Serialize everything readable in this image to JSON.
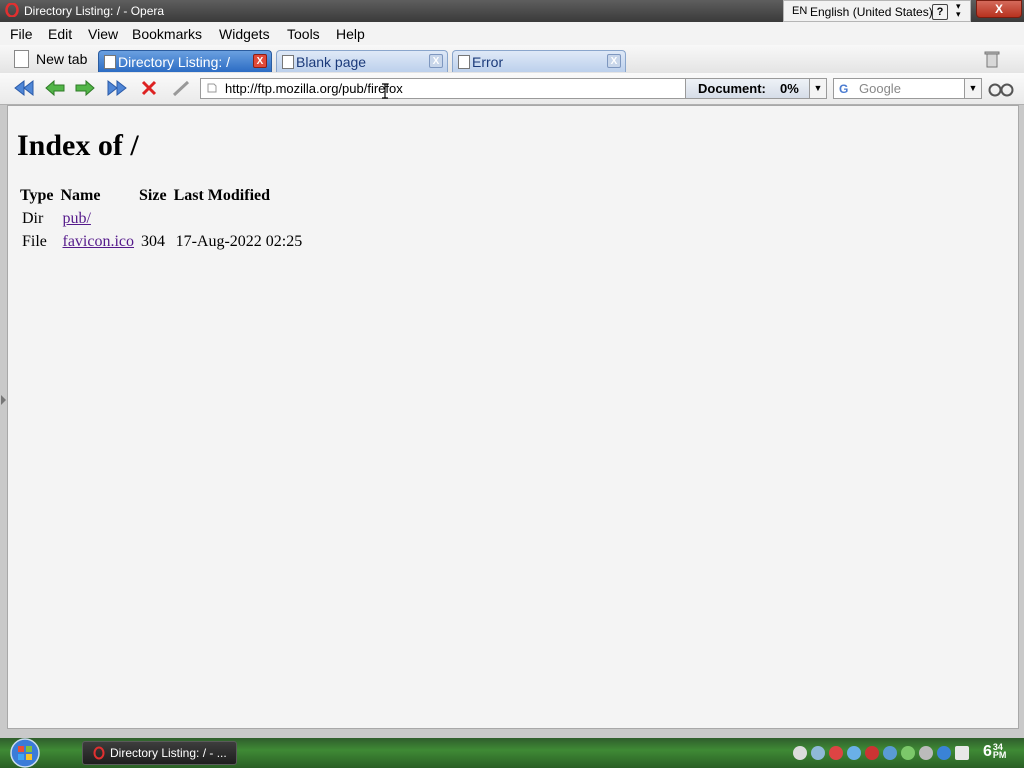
{
  "window": {
    "title": "Directory Listing: / - Opera",
    "close_label": "X"
  },
  "language_bar": {
    "code": "EN",
    "name": "English (United States)",
    "help_label": "?"
  },
  "menu": {
    "items": [
      "File",
      "Edit",
      "View",
      "Bookmarks",
      "Widgets",
      "Tools",
      "Help"
    ]
  },
  "tabs": {
    "new_tab_label": "New tab",
    "items": [
      {
        "label": "Directory Listing: /",
        "active": true
      },
      {
        "label": "Blank page",
        "active": false
      },
      {
        "label": "Error",
        "active": false
      }
    ],
    "close_label": "X"
  },
  "address_bar": {
    "url": "http://ftp.mozilla.org/pub/firefox",
    "progress_label": "Document:",
    "progress_value": "0%",
    "search_placeholder": "Google"
  },
  "page": {
    "heading": "Index of /",
    "columns": [
      "Type",
      "Name",
      "Size",
      "Last Modified"
    ],
    "rows": [
      {
        "type": "Dir",
        "name": "pub/",
        "size": "",
        "modified": ""
      },
      {
        "type": "File",
        "name": "favicon.ico",
        "size": "304",
        "modified": "17-Aug-2022 02:25"
      }
    ]
  },
  "taskbar": {
    "task_label": "Directory Listing: / - ...",
    "clock_hour": "6",
    "clock_minute": "34",
    "clock_ampm": "PM"
  }
}
